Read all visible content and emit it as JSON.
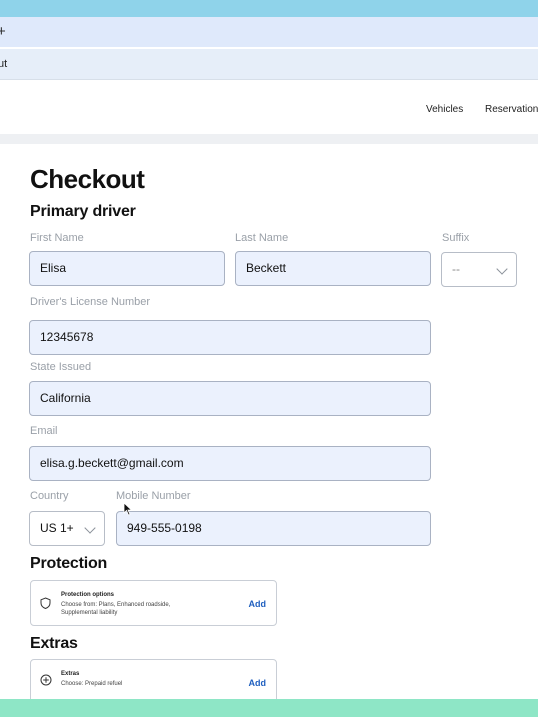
{
  "browser": {
    "tab_glyph": "+",
    "address_text": "ut"
  },
  "site_nav": {
    "links": [
      "Vehicles",
      "Reservations"
    ]
  },
  "page": {
    "title": "Checkout",
    "primary_driver_heading": "Primary driver",
    "labels": {
      "first_name": "First Name",
      "last_name": "Last Name",
      "suffix": "Suffix",
      "license": "Driver's License Number",
      "state": "State Issued",
      "email": "Email",
      "country": "Country",
      "mobile": "Mobile Number"
    },
    "values": {
      "first_name": "Elisa",
      "last_name": "Beckett",
      "suffix": "--",
      "license": "12345678",
      "state": "California",
      "email": "elisa.g.beckett@gmail.com",
      "country": "US 1+",
      "mobile": "949-555-0198"
    }
  },
  "protection": {
    "heading": "Protection",
    "card_title": "Protection options",
    "card_desc": "Choose from: Plans, Enhanced roadside, Supplemental liability",
    "add_label": "Add",
    "icon": "shield-icon"
  },
  "extras": {
    "heading": "Extras",
    "card_title": "Extras",
    "card_desc": "Choose: Prepaid refuel",
    "add_label": "Add",
    "icon": "plus-circle-icon"
  },
  "colors": {
    "top_bar": "#8fd3ea",
    "bottom_bar": "#8ee6c6",
    "field_bg": "#ebf1fd",
    "link_blue": "#1f5fbf"
  }
}
